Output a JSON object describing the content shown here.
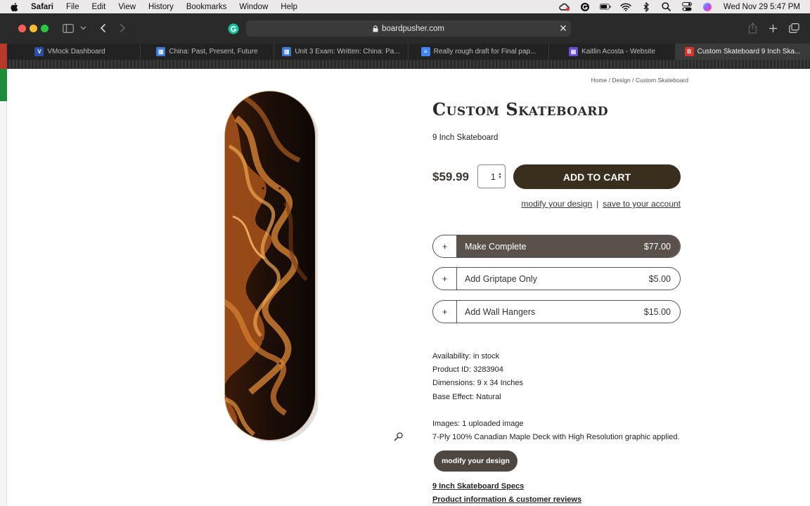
{
  "menubar": {
    "app": "Safari",
    "items": [
      "File",
      "Edit",
      "View",
      "History",
      "Bookmarks",
      "Window",
      "Help"
    ],
    "clock": "Wed Nov 29  5:47 PM"
  },
  "toolbar": {
    "url": "boardpusher.com"
  },
  "tabs": [
    {
      "label": "VMock Dashboard",
      "favicon_color": "#2b4fa8"
    },
    {
      "label": "China: Past, Present, Future",
      "favicon_color": "#3d7bd9"
    },
    {
      "label": "Unit 3 Exam: Written: China: Pa...",
      "favicon_color": "#3d7bd9"
    },
    {
      "label": "Really rough draft for Final pap...",
      "favicon_color": "#4285f4"
    },
    {
      "label": "Kaitlin Acosta - Website",
      "favicon_color": "#6a4bd1"
    },
    {
      "label": "Custom Skateboard 9 Inch Ska...",
      "favicon_color": "#d9342b"
    }
  ],
  "breadcrumb": "Home / Design / Custom Skateboard",
  "product": {
    "title": "Custom Skateboard",
    "subtitle": "9 Inch Skateboard",
    "price": "$59.99",
    "quantity": "1",
    "add_to_cart": "ADD TO CART",
    "modify_link": "modify your design",
    "separator": "|",
    "save_link": "save to your account"
  },
  "addons": [
    {
      "plus": "+",
      "label": "Make Complete",
      "price": "$77.00",
      "selected": true
    },
    {
      "plus": "+",
      "label": "Add Griptape Only",
      "price": "$5.00",
      "selected": false
    },
    {
      "plus": "+",
      "label": "Add Wall Hangers",
      "price": "$15.00",
      "selected": false
    }
  ],
  "details": {
    "availability": "Availability: in stock",
    "product_id": "Product ID: 3283904",
    "dimensions": "Dimensions: 9 x 34 Inches",
    "base_effect": "Base Effect: Natural",
    "images": "Images: 1 uploaded image",
    "description": "7-Ply 100% Canadian Maple Deck with High Resolution graphic applied."
  },
  "modify_button": "modify your design",
  "links": {
    "specs": "9 Inch Skateboard Specs",
    "reviews": "Product information & customer reviews"
  },
  "colors": {
    "cart_button": "#3a2e1f",
    "selected_addon": "#5a524a"
  }
}
